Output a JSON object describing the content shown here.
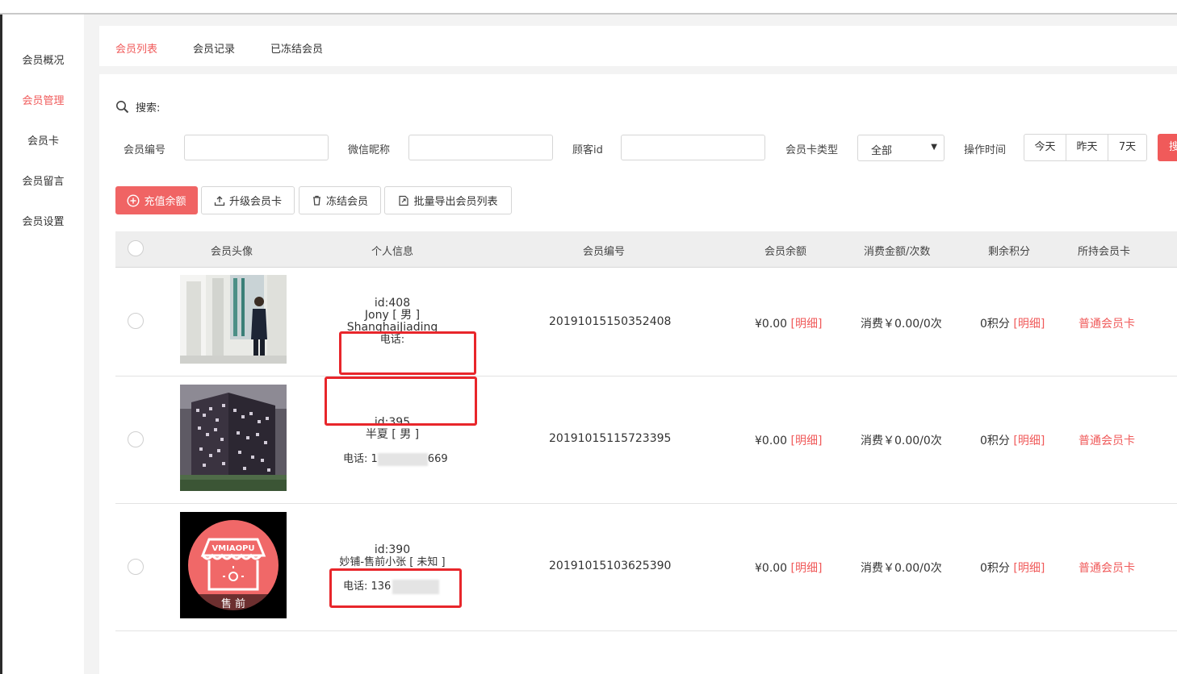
{
  "sidebar": {
    "items": [
      {
        "label": "会员概况",
        "active": false
      },
      {
        "label": "会员管理",
        "active": true
      },
      {
        "label": "会员卡",
        "active": false
      },
      {
        "label": "会员留言",
        "active": false
      },
      {
        "label": "会员设置",
        "active": false
      }
    ]
  },
  "tabs": [
    {
      "label": "会员列表",
      "active": true
    },
    {
      "label": "会员记录",
      "active": false
    },
    {
      "label": "已冻结会员",
      "active": false
    }
  ],
  "search": {
    "title": "搜索:",
    "member_no_label": "会员编号",
    "wechat_nick_label": "微信昵称",
    "customer_id_label": "顾客id",
    "card_type_label": "会员卡类型",
    "card_type_value": "全部",
    "op_time_label": "操作时间",
    "time_buttons": [
      "今天",
      "昨天",
      "7天"
    ],
    "search_button": "搜"
  },
  "actions": {
    "recharge": "充值余额",
    "upgrade": "升级会员卡",
    "freeze": "冻结会员",
    "export": "批量导出会员列表"
  },
  "table": {
    "headers": [
      "会员头像",
      "个人信息",
      "会员编号",
      "会员余额",
      "消费金额/次数",
      "剩余积分",
      "所持会员卡"
    ],
    "detail_link": "[明细]",
    "rows": [
      {
        "id_line": "id:408",
        "name_line": "Jony [ 男 ]",
        "location_line": "ShanghaiJiading",
        "phone_line": "电话:",
        "member_no": "20191015150352408",
        "balance": "¥0.00",
        "consume": "消费￥0.00/0次",
        "points": "0积分",
        "card": "普通会员卡"
      },
      {
        "id_line": "id:395",
        "name_line": "半夏 [ 男 ]",
        "phone_prefix": "电话: 1",
        "phone_suffix": "669",
        "member_no": "20191015115723395",
        "balance": "¥0.00",
        "consume": "消费￥0.00/0次",
        "points": "0积分",
        "card": "普通会员卡"
      },
      {
        "id_line": "id:390",
        "name_line": "妙铺-售前小张 [ 未知 ]",
        "phone_prefix": "电话: 136",
        "member_no": "20191015103625390",
        "balance": "¥0.00",
        "consume": "消费￥0.00/0次",
        "points": "0积分",
        "card": "普通会员卡",
        "avatar_brand": "VMIAOPU",
        "avatar_caption": "售 前"
      }
    ]
  },
  "colors": {
    "accent": "#f05a5a",
    "highlight_box": "#e8262b"
  }
}
